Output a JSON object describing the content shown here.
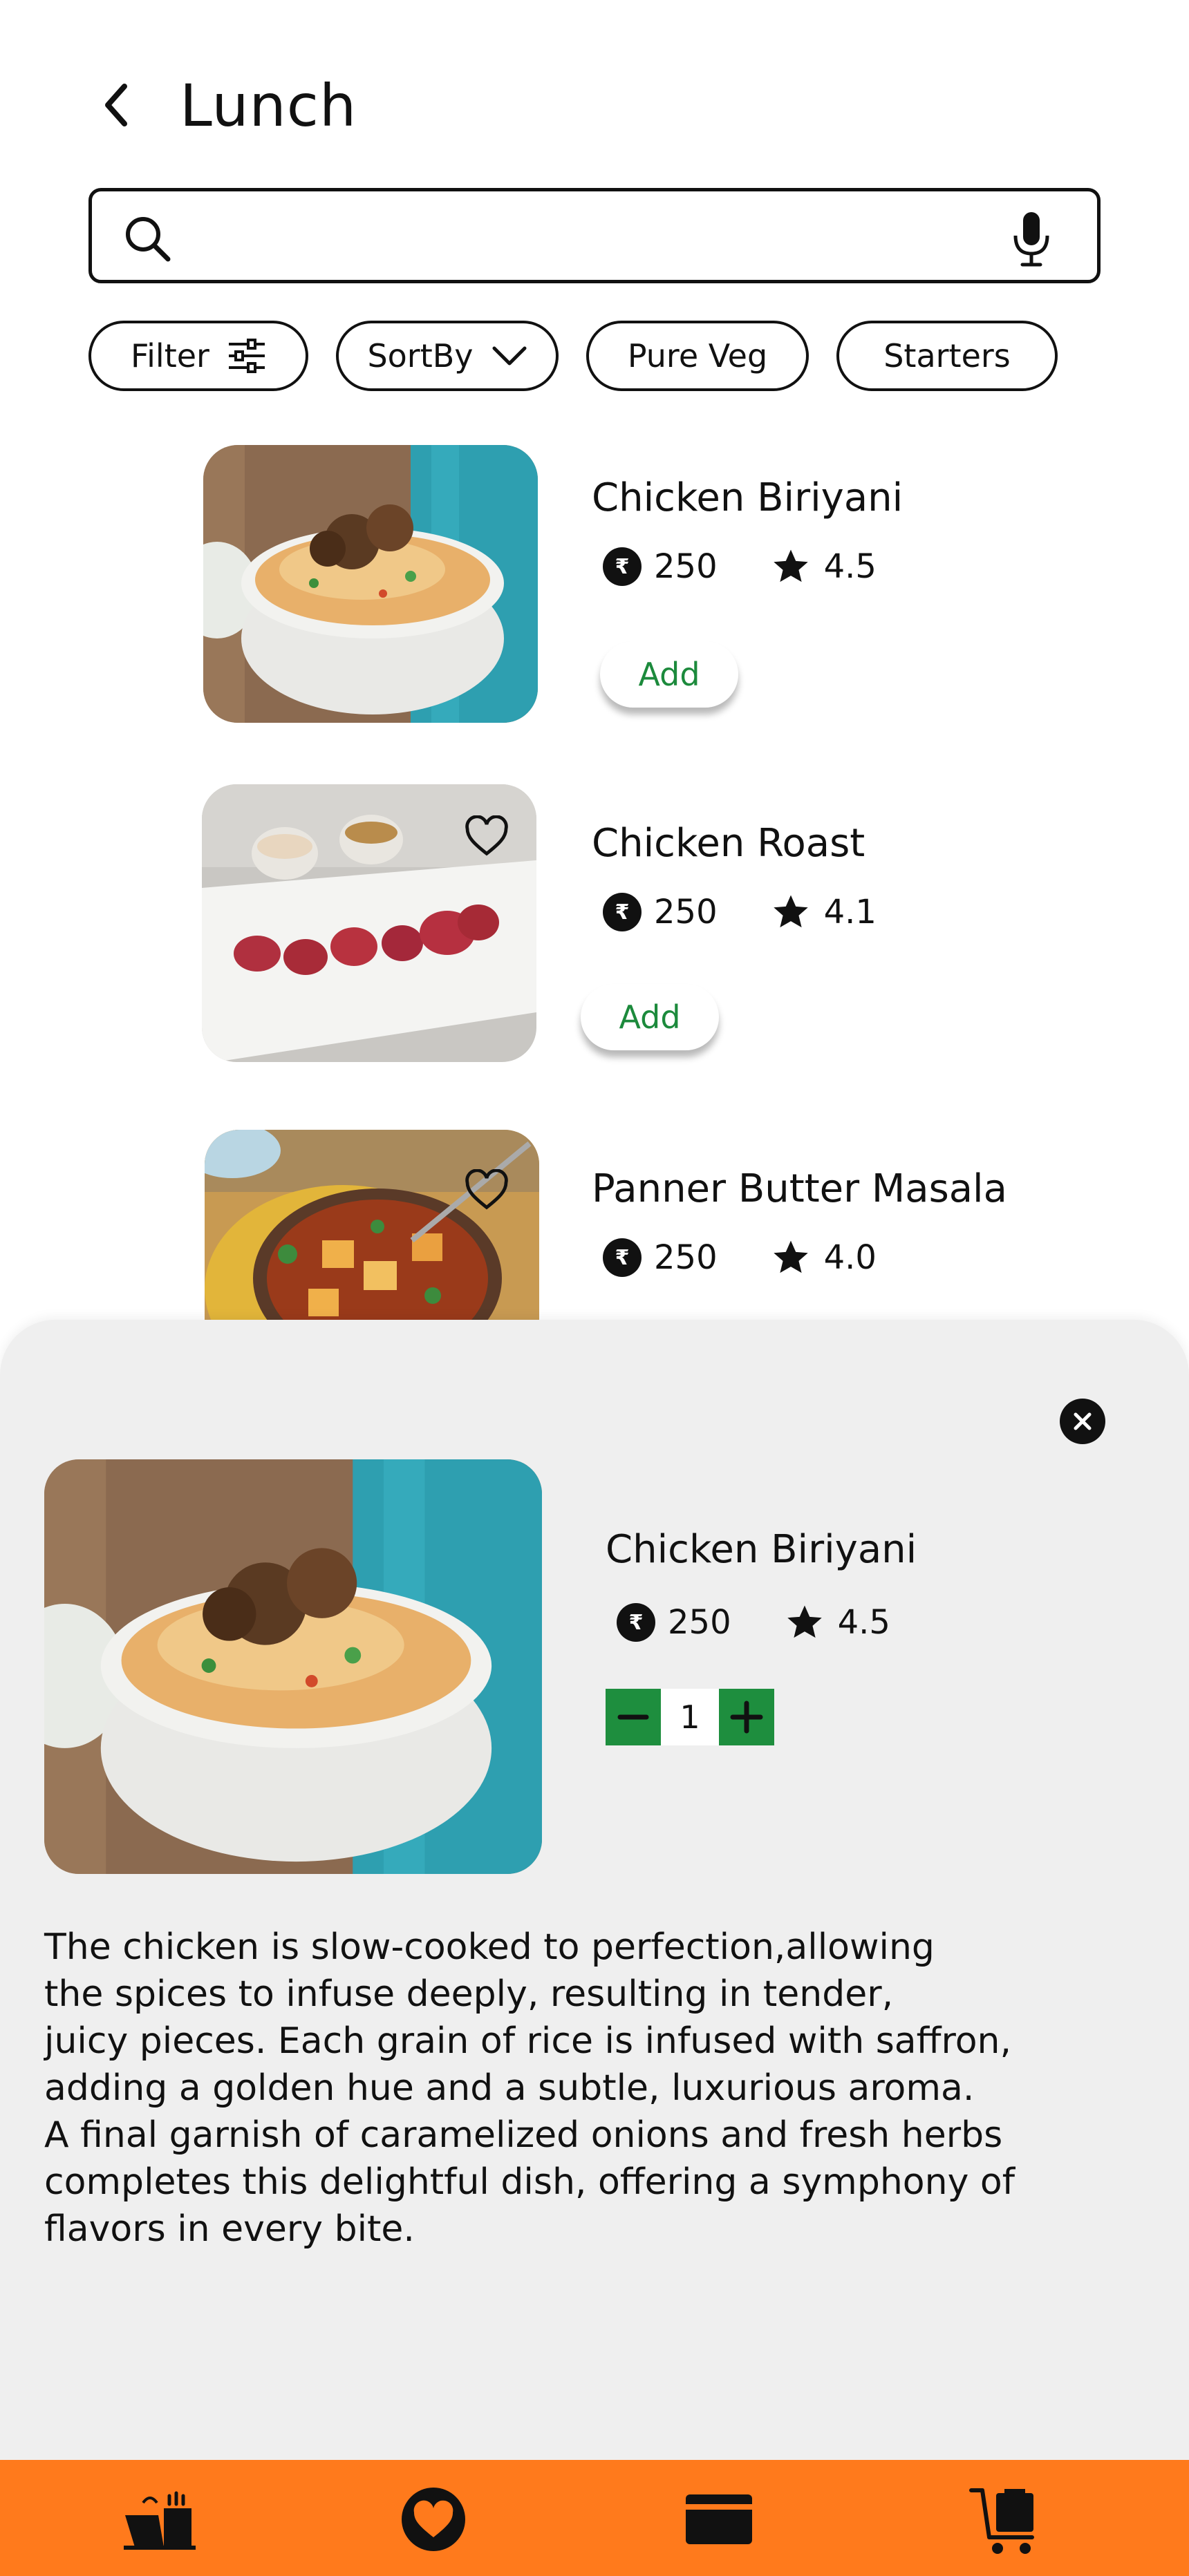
{
  "header": {
    "title": "Lunch",
    "back_icon": "chevron-left-icon"
  },
  "search": {
    "placeholder": "",
    "value": "",
    "search_icon": "search-icon",
    "mic_icon": "microphone-icon"
  },
  "chips": [
    {
      "label": "Filter",
      "icon": "sliders-icon"
    },
    {
      "label": "SortBy",
      "icon": "chevron-down-icon"
    },
    {
      "label": "Pure Veg"
    },
    {
      "label": "Starters"
    }
  ],
  "items": [
    {
      "name": "Chicken Biriyani",
      "price": "250",
      "rating": "4.5",
      "add_label": "Add",
      "currency_icon": "rupee-icon",
      "rating_icon": "star-icon",
      "image": "biryani-photo"
    },
    {
      "name": "Chicken Roast",
      "price": "250",
      "rating": "4.1",
      "add_label": "Add",
      "currency_icon": "rupee-icon",
      "rating_icon": "star-icon",
      "favorite_icon": "heart-outline-icon",
      "image": "chicken-roast-photo"
    },
    {
      "name": "Panner Butter Masala",
      "price": "250",
      "rating": "4.0",
      "currency_icon": "rupee-icon",
      "rating_icon": "star-icon",
      "favorite_icon": "heart-outline-icon",
      "image": "paneer-masala-photo"
    }
  ],
  "detail_sheet": {
    "name": "Chicken Biriyani",
    "price": "250",
    "rating": "4.5",
    "quantity": "1",
    "close_icon": "close-icon",
    "decrement_icon": "minus-icon",
    "increment_icon": "plus-icon",
    "description": "The chicken is slow-cooked to perfection,allowing\nthe spices to infuse deeply, resulting in tender,\njuicy pieces. Each grain of rice is infused with saffron,\nadding a golden hue and a subtle, luxurious aroma.\nA final garnish of caramelized onions and fresh herbs\ncompletes this delightful dish, offering a symphony of\nflavors in every bite."
  },
  "bottom_nav": [
    {
      "icon": "food-delivery-icon"
    },
    {
      "icon": "heart-filled-icon"
    },
    {
      "icon": "card-icon"
    },
    {
      "icon": "cart-icon"
    }
  ],
  "colors": {
    "accent_green": "#1e8e3e",
    "nav_orange": "#ff7a1c",
    "sheet_bg": "#efefef"
  }
}
